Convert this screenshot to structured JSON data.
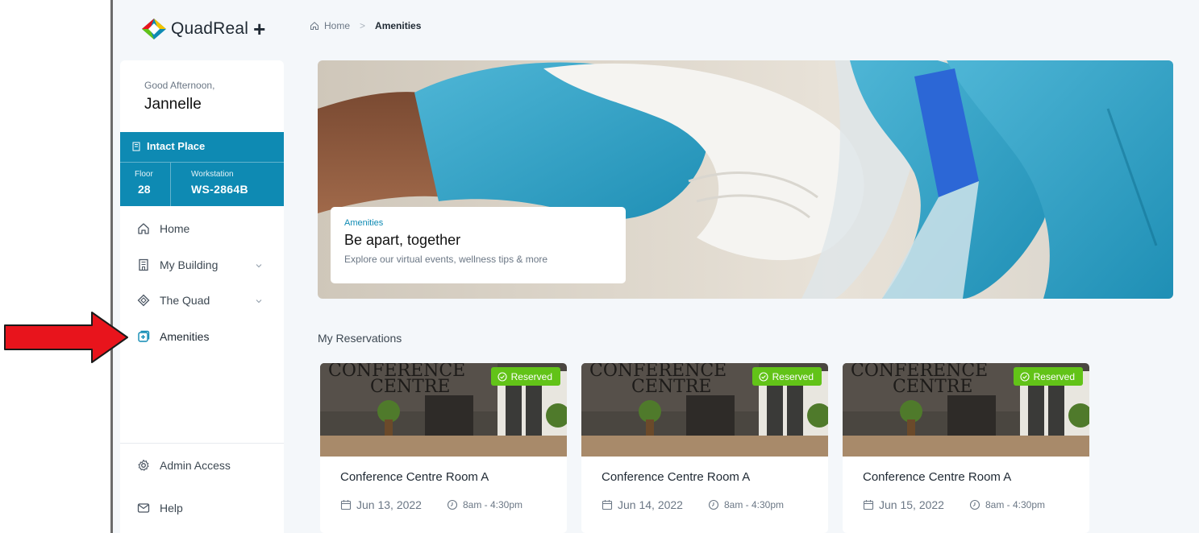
{
  "app": {
    "logo_text": "QuadReal",
    "logo_plus": "+"
  },
  "breadcrumb": {
    "home": "Home",
    "separator": ">",
    "current": "Amenities"
  },
  "user": {
    "greeting": "Good Afternoon,",
    "name": "Jannelle"
  },
  "place": {
    "name": "Intact Place",
    "floor_label": "Floor",
    "floor_value": "28",
    "workstation_label": "Workstation",
    "workstation_value": "WS-2864B"
  },
  "nav": {
    "home": "Home",
    "my_building": "My Building",
    "the_quad": "The Quad",
    "amenities": "Amenities",
    "admin_access": "Admin Access",
    "help": "Help"
  },
  "hero": {
    "tag": "Amenities",
    "title": "Be apart, together",
    "subtitle": "Explore our virtual events, wellness tips & more"
  },
  "reservations": {
    "title": "My Reservations",
    "items": [
      {
        "title": "Conference Centre Room A",
        "date": "Jun 13, 2022",
        "time": "8am - 4:30pm",
        "badge": "Reserved"
      },
      {
        "title": "Conference Centre Room A",
        "date": "Jun 14, 2022",
        "time": "8am - 4:30pm",
        "badge": "Reserved"
      },
      {
        "title": "Conference Centre Room A",
        "date": "Jun 15, 2022",
        "time": "8am - 4:30pm",
        "badge": "Reserved"
      }
    ]
  },
  "colors": {
    "accent": "#0e8ab3",
    "badge": "#62c318",
    "arrow": "#e8141c"
  },
  "icons": [
    "home-icon",
    "building-icon",
    "quad-icon",
    "amenities-icon",
    "gear-icon",
    "mail-icon",
    "calendar-icon",
    "clock-icon",
    "check-circle-icon",
    "chevron-down-icon"
  ]
}
